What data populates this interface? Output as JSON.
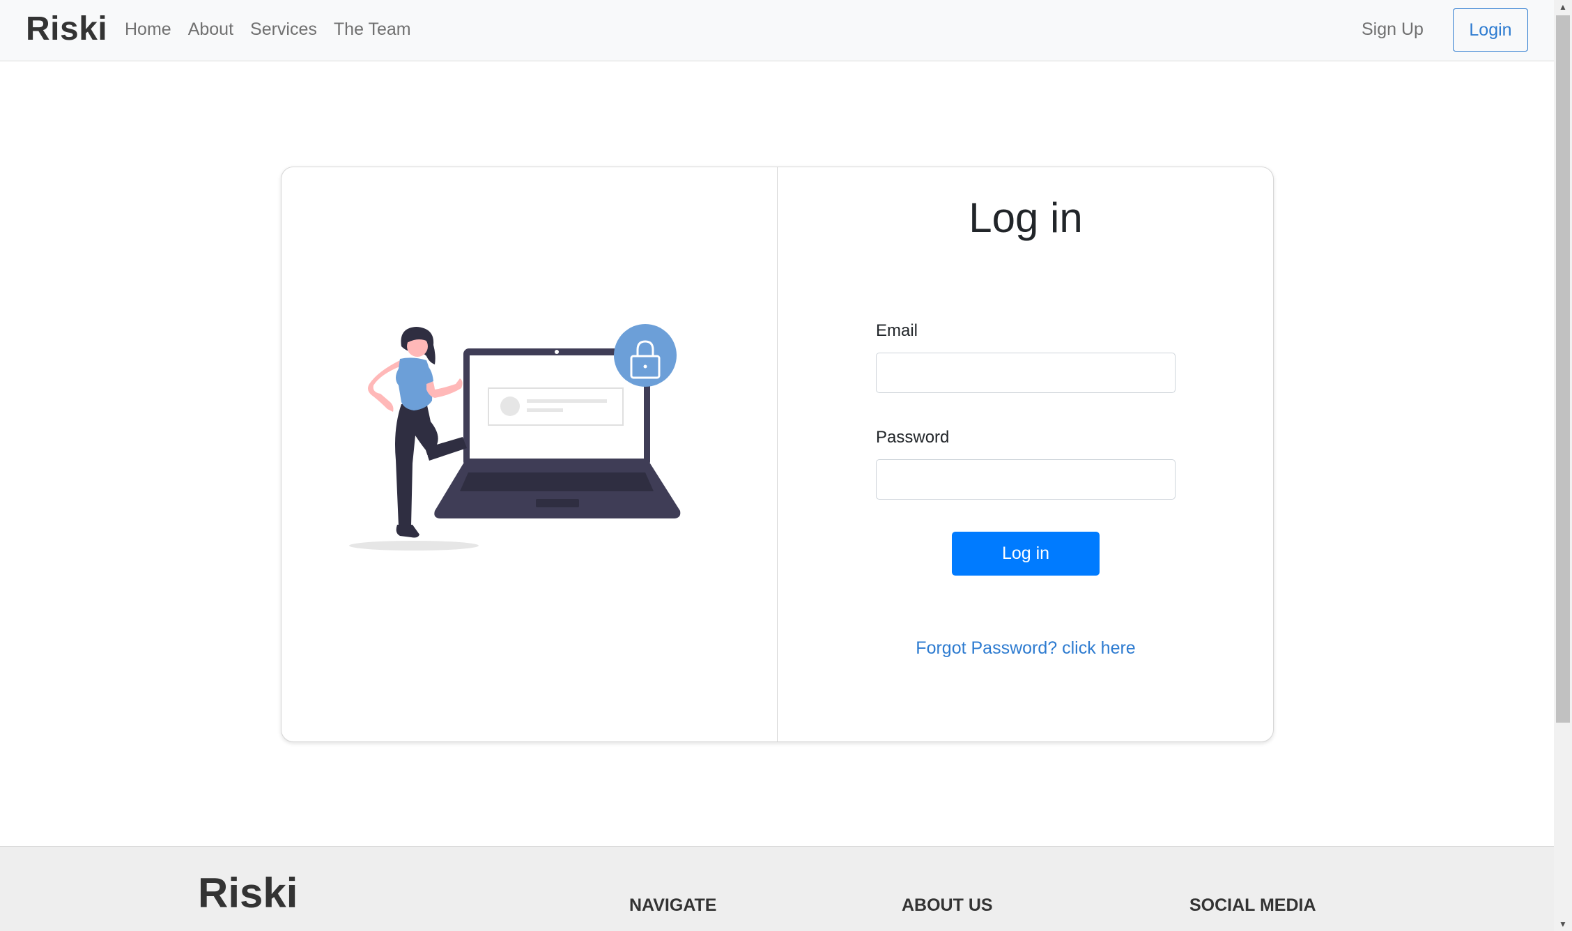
{
  "navbar": {
    "brand": "Riski",
    "links": [
      "Home",
      "About",
      "Services",
      "The Team"
    ],
    "signup_label": "Sign Up",
    "login_label": "Login"
  },
  "login_card": {
    "title": "Log in",
    "email_label": "Email",
    "email_value": "",
    "password_label": "Password",
    "password_value": "",
    "submit_label": "Log in",
    "forgot_link": "Forgot Password? click here"
  },
  "footer": {
    "brand": "Riski",
    "headings": [
      "NAVIGATE",
      "ABOUT US",
      "SOCIAL MEDIA"
    ]
  },
  "colors": {
    "primary": "#007bff",
    "link": "#2d7bd0",
    "navbar_bg": "#f8f9fa",
    "footer_bg": "#eeeeee",
    "illustration_accent": "#6c9fd8",
    "illustration_dark": "#3f3d56"
  },
  "icons": {
    "illustration": "person-with-laptop-lock-illustration",
    "lock": "lock-icon"
  }
}
